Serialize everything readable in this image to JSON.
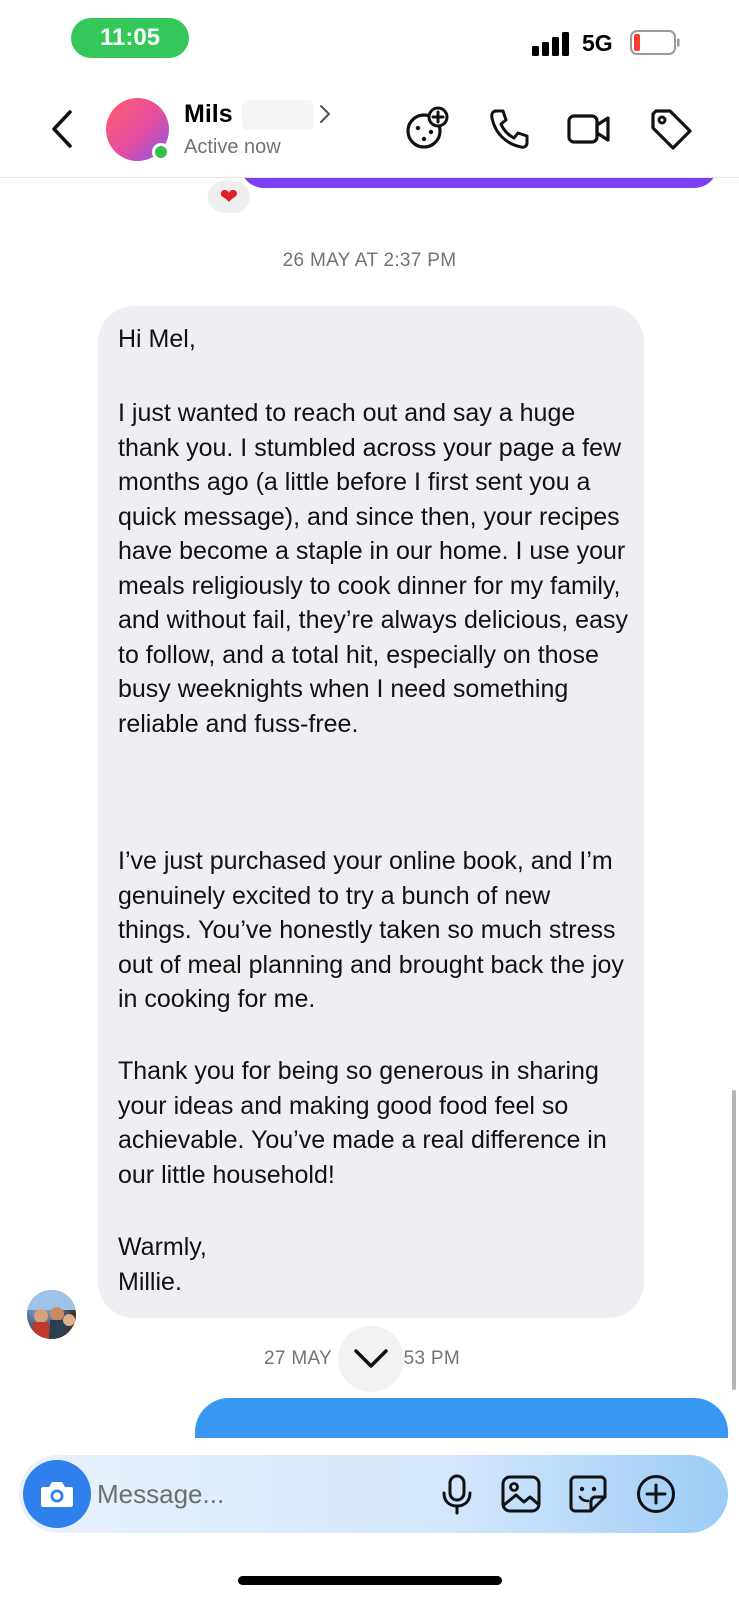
{
  "status_bar": {
    "time": "11:05",
    "network": "5G"
  },
  "header": {
    "contact_name": "Mils",
    "status": "Active now"
  },
  "chat": {
    "reaction": "❤",
    "timestamp_1": "26 MAY AT 2:37 PM",
    "message_paragraphs": [
      "Hi Mel,",
      "I just wanted to reach out and say a huge thank you. I stumbled across your page a few months ago (a little before I first sent you a quick message), and since then, your recipes have become a staple in our home. I use your meals religiously to cook dinner for my family, and without fail, they’re always delicious, easy to follow, and a total hit, especially on those busy weeknights when I need something reliable and fuss-free.",
      "I’ve just purchased your online book, and I’m genuinely excited to try a bunch of new things. You’ve honestly taken so much stress out of meal planning and brought back the joy in cooking for me.",
      "Thank you for being so generous in sharing your ideas and making good food feel so achievable. You’ve made a real difference in our little household!",
      "Warmly,\nMillie."
    ],
    "timestamp_2_left": "27 MAY",
    "timestamp_2_right": ":53 PM"
  },
  "composer": {
    "placeholder": "Message..."
  },
  "colors": {
    "status_green": "#34c759",
    "accent_blue": "#3897f0",
    "bubble_gray": "#efeff3",
    "purple": "#7a3ff2"
  }
}
